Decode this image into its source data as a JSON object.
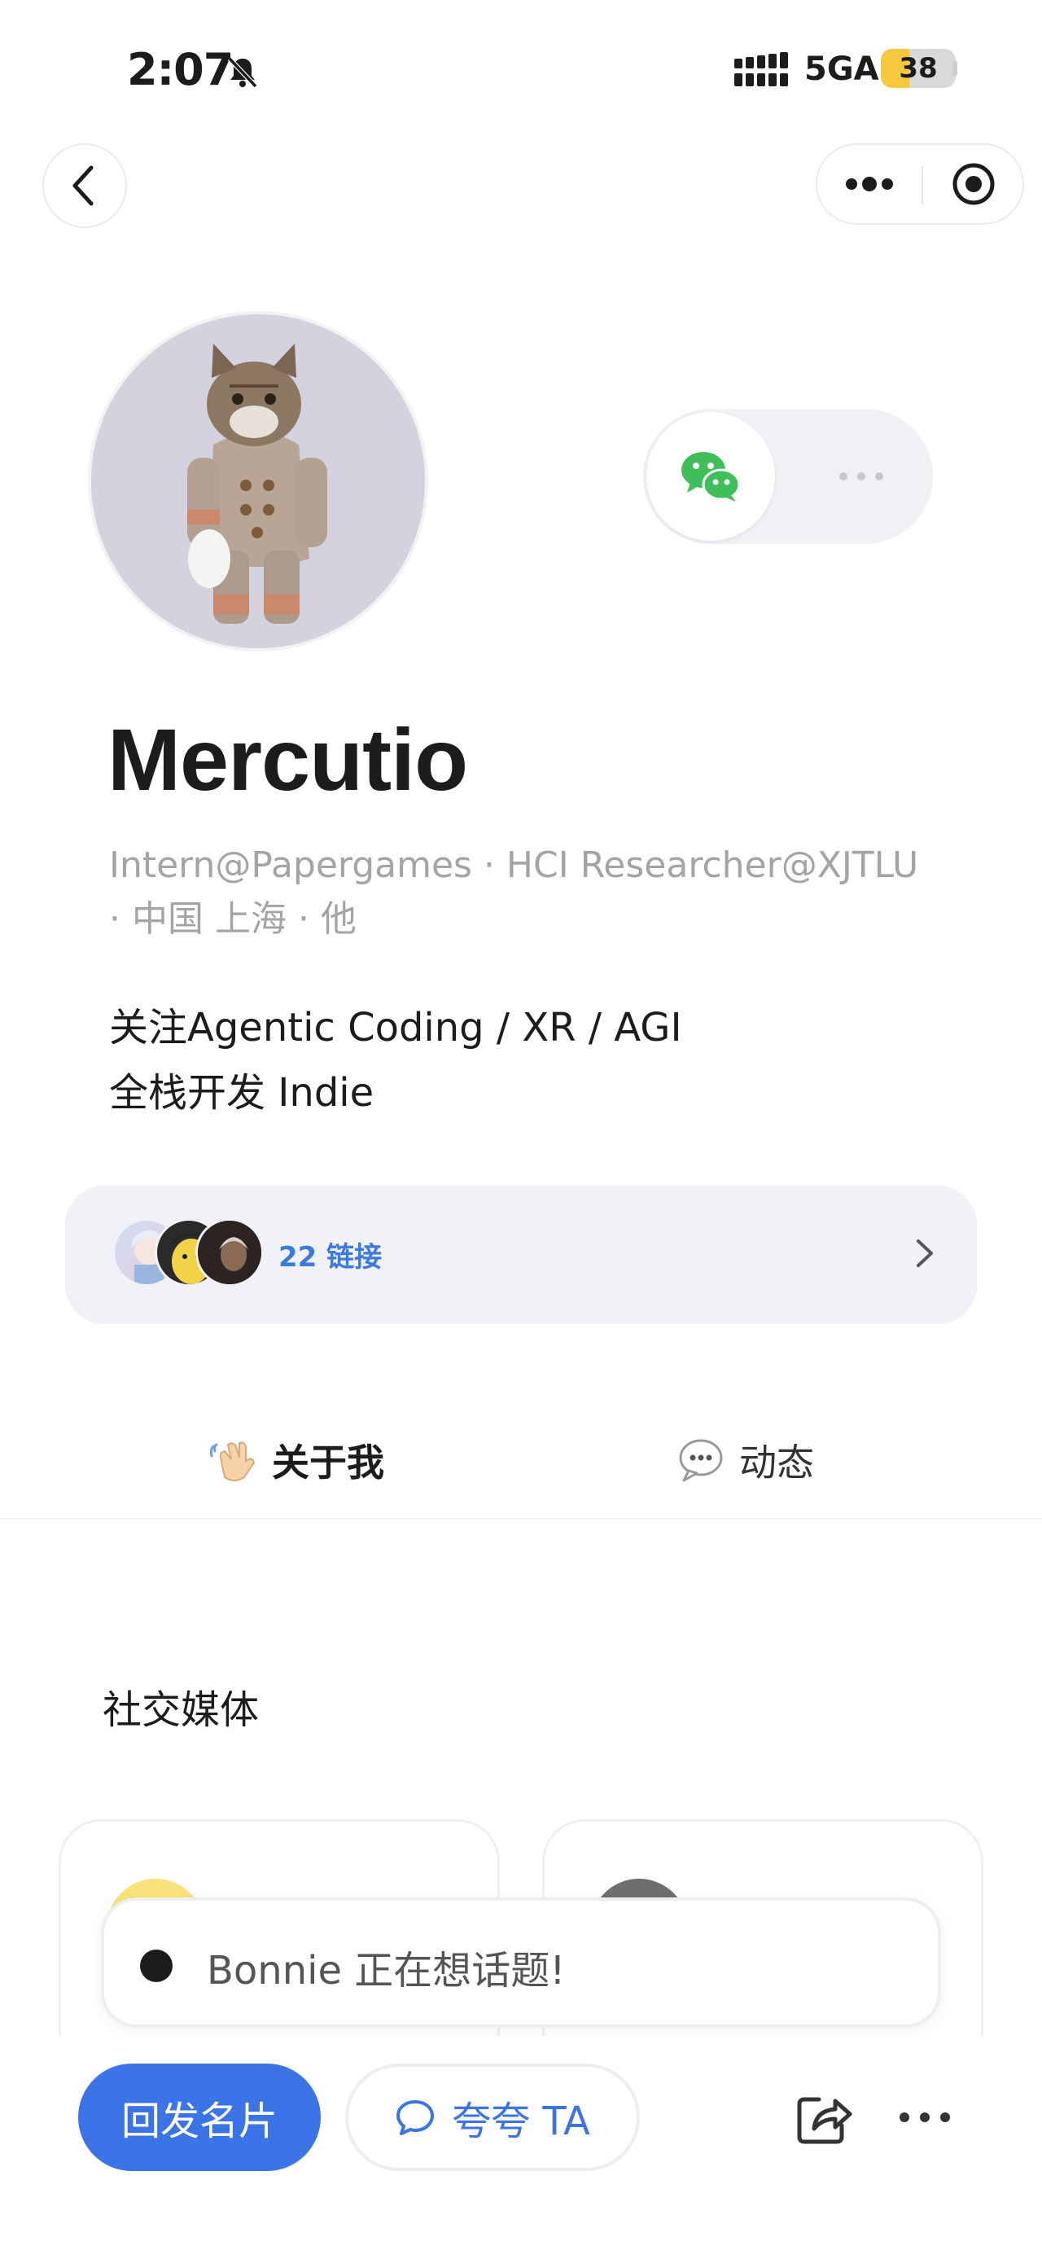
{
  "status_bar": {
    "time": "2:07",
    "network": "5GA",
    "battery": "38",
    "battery_level_percent": 38,
    "icons": [
      "bell-slash-icon",
      "signal-icon"
    ]
  },
  "nav": {
    "icons": [
      "chevron-left-icon",
      "more-dots-icon",
      "record-target-icon"
    ]
  },
  "profile": {
    "name": "Mercutio",
    "subtitle": "Intern@Papergames · HCI Researcher@XJTLU · 中国 上海 · 他",
    "bio": "关注Agentic Coding / XR / AGI\n全栈开发 Indie"
  },
  "contact_toggle": {
    "icons": [
      "wechat-icon",
      "more-dots-icon"
    ],
    "accent": "#3fbf5a"
  },
  "links": {
    "label": "22 链接",
    "avatars": [
      "anime-girl-avatar",
      "cartoon-face-avatar",
      "dark-portrait-avatar"
    ]
  },
  "tabs": [
    {
      "label": "关于我",
      "icon": "waving-hand-icon",
      "active": true
    },
    {
      "label": "动态",
      "icon": "speech-bubble-icon",
      "active": false
    }
  ],
  "section": {
    "social_title": "社交媒体"
  },
  "toast": {
    "text": "Bonnie 正在想话题!"
  },
  "actions": {
    "primary": "回发名片",
    "secondary": "夸夸 TA",
    "icons": [
      "share-icon",
      "more-dots-icon"
    ]
  },
  "colors": {
    "accent_blue": "#3b74e6",
    "link_blue": "#3d7ae0",
    "battery_yellow": "#f7c83c",
    "muted_text": "#a3a3a8"
  }
}
